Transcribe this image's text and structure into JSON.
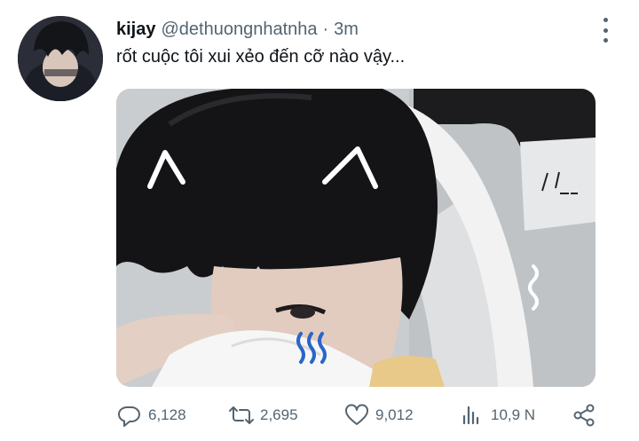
{
  "tweet": {
    "display_name": "kijay",
    "handle": "@dethuongnhatnha",
    "separator": "·",
    "time": "3m",
    "text": "rốt cuộc tôi xui xẻo đến cỡ nào vậy..."
  },
  "icons": {
    "more": "more-vertical-icon",
    "reply": "reply-icon",
    "retweet": "retweet-icon",
    "like": "heart-icon",
    "views": "views-icon",
    "share": "share-icon"
  },
  "actions": {
    "replies": "6,128",
    "retweets": "2,695",
    "likes": "9,012",
    "views": "10,9 N"
  },
  "colors": {
    "text_primary": "#0f1419",
    "text_secondary": "#536471",
    "background": "#ffffff"
  }
}
